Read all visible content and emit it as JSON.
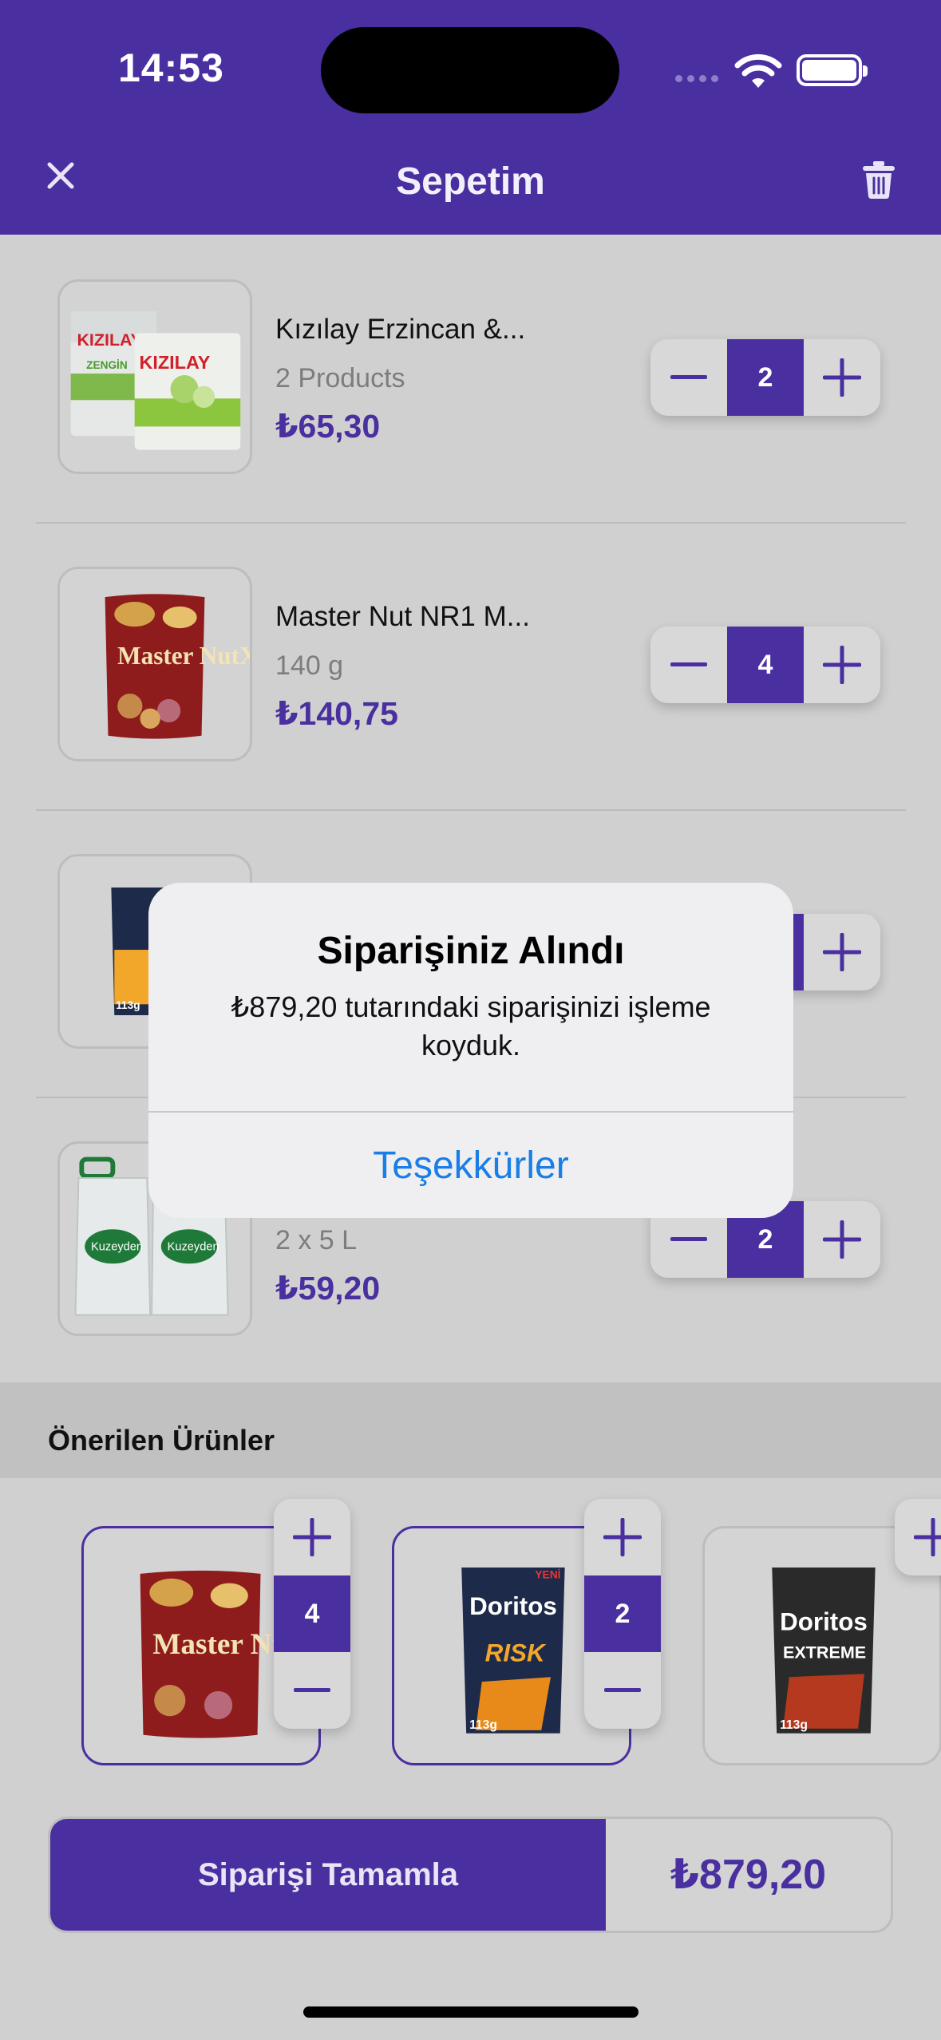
{
  "status": {
    "time": "14:53"
  },
  "header": {
    "title": "Sepetim"
  },
  "cart": {
    "items": [
      {
        "name": "Kızılay Erzincan &...",
        "sub": "2 Products",
        "price": "₺65,30",
        "qty": "2"
      },
      {
        "name": "Master Nut NR1 M...",
        "sub": "140 g",
        "price": "₺140,75",
        "qty": "4"
      },
      {
        "name": "",
        "sub": "",
        "price": "",
        "qty": ""
      },
      {
        "name": "",
        "sub": "2 x 5 L",
        "price": "₺59,20",
        "qty": "2"
      }
    ]
  },
  "suggestions": {
    "title": "Önerilen Ürünler",
    "items": [
      {
        "qty": "4"
      },
      {
        "qty": "2"
      },
      {
        "qty": ""
      }
    ]
  },
  "product_labels": {
    "kizilay": "KIZILAY",
    "kizilay_sub": "ZENGİN",
    "master_nut": "Master NutX",
    "doritos": "Doritos",
    "risk": "RISK",
    "extreme": "EXTREME",
    "weight": "113g",
    "kuzeyden": "Kuzeyden",
    "yeni": "YENİ"
  },
  "checkout": {
    "label": "Siparişi Tamamla",
    "total": "₺879,20"
  },
  "alert": {
    "title": "Siparişiniz Alındı",
    "message": "₺879,20 tutarındaki siparişinizi işleme koyduk.",
    "button": "Teşekkürler"
  },
  "colors": {
    "brand": "#4a2fa0",
    "alert_button": "#1a7ee6",
    "dim_overlay": "#d0d0d0"
  }
}
